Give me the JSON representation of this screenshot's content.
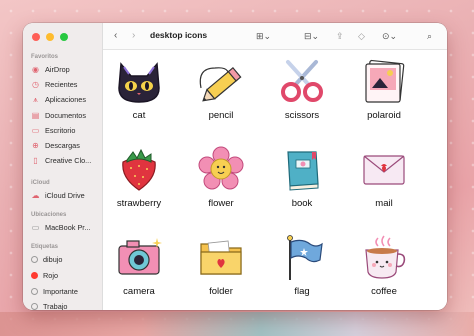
{
  "window": {
    "title": "desktop icons"
  },
  "sidebar": {
    "sections": [
      {
        "title": "Favoritos",
        "items": [
          "AirDrop",
          "Recientes",
          "Aplicaciones",
          "Documentos",
          "Escritorio",
          "Descargas",
          "Creative Clo..."
        ]
      },
      {
        "title": "iCloud",
        "items": [
          "iCloud Drive"
        ]
      },
      {
        "title": "Ubicaciones",
        "items": [
          "MacBook Pr..."
        ]
      },
      {
        "title": "Etiquetas",
        "items": [
          "dibujo",
          "Rojo",
          "Importante",
          "Trabajo"
        ]
      }
    ]
  },
  "files": [
    {
      "name": "cat",
      "icon": "cat-icon"
    },
    {
      "name": "pencil",
      "icon": "pencil-icon"
    },
    {
      "name": "scissors",
      "icon": "scissors-icon"
    },
    {
      "name": "polaroid",
      "icon": "polaroid-icon"
    },
    {
      "name": "strawberry",
      "icon": "strawberry-icon"
    },
    {
      "name": "flower",
      "icon": "flower-icon"
    },
    {
      "name": "book",
      "icon": "book-icon"
    },
    {
      "name": "mail",
      "icon": "mail-icon"
    },
    {
      "name": "camera",
      "icon": "camera-icon"
    },
    {
      "name": "folder",
      "icon": "folder-icon"
    },
    {
      "name": "flag",
      "icon": "flag-icon"
    },
    {
      "name": "coffee",
      "icon": "coffee-icon"
    }
  ],
  "colors": {
    "accent": "#e06470",
    "sidebar_bg": "#f0ecec",
    "desktop_bg": "#eab0b3"
  }
}
